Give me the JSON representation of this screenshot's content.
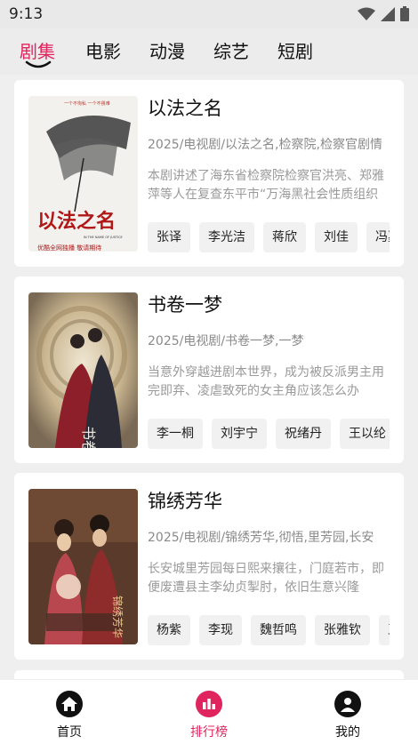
{
  "status": {
    "time": "9:13"
  },
  "tabs": [
    {
      "label": "剧集",
      "active": true
    },
    {
      "label": "电影"
    },
    {
      "label": "动漫"
    },
    {
      "label": "综艺"
    },
    {
      "label": "短剧"
    }
  ],
  "items": [
    {
      "title": "以法之名",
      "meta": "2025/电视剧/以法之名,检察院,检察官剧情",
      "desc": "本剧讲述了海东省检察院检察官洪亮、郑雅萍等人在复查东平市“万海黑社会性质组织案”过程中",
      "actors": [
        "张译",
        "李光洁",
        "蒋欣",
        "刘佳",
        "冯嘉怡"
      ],
      "poster_text": "以法之名",
      "poster_sub1": "一个不徇私  一个不畏难",
      "poster_sub2": "IN THE NAME OF JUSTICE",
      "poster_sub3": "优酷全网独播  敬请期待"
    },
    {
      "title": "书卷一梦",
      "meta": "2025/电视剧/书卷一梦,一梦",
      "desc": "当意外穿越进剧本世界，成为被反派男主用完即弃、凌虐致死的女主角应该怎么办",
      "actors": [
        "李一桐",
        "刘宇宁",
        "祝绪丹",
        "王以纶"
      ],
      "poster_text": "书卷一梦"
    },
    {
      "title": "锦绣芳华",
      "meta": "2025/电视剧/锦绣芳华,彻悟,里芳园,长安",
      "desc": "长安城里芳园每日熙来攘往，门庭若市，即便废遭县主李幼贞掣肘，依旧生意兴隆",
      "actors": [
        "杨紫",
        "李现",
        "魏哲鸣",
        "张雅钦",
        "王鹤润"
      ],
      "poster_text": "锦绣芳华"
    }
  ],
  "nav": [
    {
      "label": "首页",
      "icon": "home-icon"
    },
    {
      "label": "排行榜",
      "icon": "chart-icon",
      "active": true
    },
    {
      "label": "我的",
      "icon": "user-icon"
    }
  ],
  "colors": {
    "accent": "#e0245e",
    "background": "#efefef",
    "card": "#ffffff"
  }
}
